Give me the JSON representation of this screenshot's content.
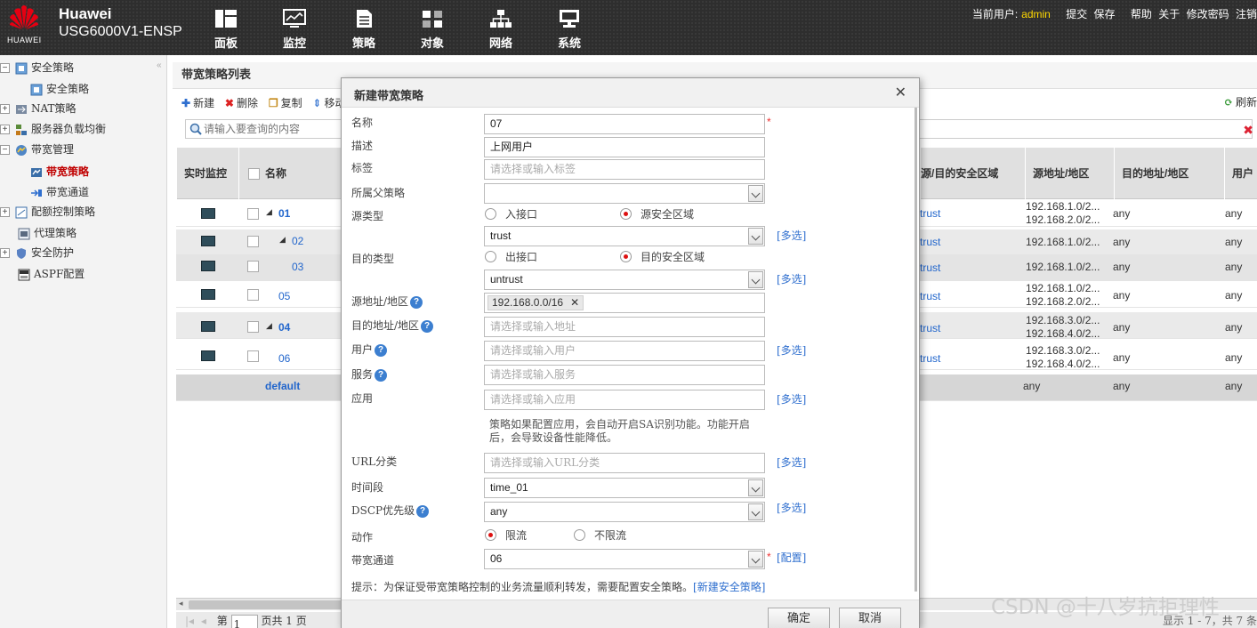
{
  "header": {
    "brand": "Huawei",
    "logo_text": "HUAWEI",
    "model": "USG6000V1-ENSP",
    "nav": [
      {
        "label": "面板",
        "icon": "dashboard-icon"
      },
      {
        "label": "监控",
        "icon": "monitor-chart-icon"
      },
      {
        "label": "策略",
        "icon": "policy-document-icon"
      },
      {
        "label": "对象",
        "icon": "objects-icon"
      },
      {
        "label": "网络",
        "icon": "network-topology-icon"
      },
      {
        "label": "系统",
        "icon": "system-computer-icon"
      }
    ],
    "user_prefix": "当前用户:",
    "username": "admin",
    "submit": "提交",
    "save": "保存",
    "help": "帮助",
    "about": "关于",
    "change_password": "修改密码",
    "logout": "注销"
  },
  "sidebar": {
    "items": [
      {
        "label": "安全策略",
        "toggle": "−"
      },
      {
        "label": "安全策略",
        "toggle": ""
      },
      {
        "label": "NAT策略",
        "toggle": "+"
      },
      {
        "label": "服务器负载均衡",
        "toggle": "+"
      },
      {
        "label": "带宽管理",
        "toggle": "−"
      },
      {
        "label": "带宽策略",
        "toggle": ""
      },
      {
        "label": "带宽通道",
        "toggle": ""
      },
      {
        "label": "配额控制策略",
        "toggle": "+"
      },
      {
        "label": "代理策略",
        "toggle": ""
      },
      {
        "label": "安全防护",
        "toggle": "+"
      },
      {
        "label": "ASPF配置",
        "toggle": ""
      }
    ]
  },
  "main": {
    "list_title": "带宽策略列表",
    "toolbar": {
      "new": "新建",
      "delete": "删除",
      "copy": "复制",
      "move": "移动",
      "refresh": "刷新"
    },
    "search_placeholder": "请输入要查询的内容",
    "columns": {
      "monitor": "实时监控",
      "name": "名称",
      "zone": "源/目的安全区域",
      "src": "源地址/地区",
      "dst": "目的地址/地区",
      "user": "用户"
    },
    "rows": [
      {
        "name": "01",
        "zone": "trust",
        "src1": "192.168.1.0/2...",
        "src2": "192.168.2.0/2...",
        "dst": "any",
        "user": "any"
      },
      {
        "name": "02",
        "zone": "trust",
        "src1": "192.168.1.0/2...",
        "src2": "",
        "dst": "any",
        "user": "any"
      },
      {
        "name": "03",
        "zone": "trust",
        "src1": "192.168.1.0/2...",
        "src2": "",
        "dst": "any",
        "user": "any"
      },
      {
        "name": "05",
        "zone": "trust",
        "src1": "192.168.1.0/2...",
        "src2": "192.168.2.0/2...",
        "dst": "any",
        "user": "any"
      },
      {
        "name": "04",
        "zone": "trust",
        "src1": "192.168.3.0/2...",
        "src2": "192.168.4.0/2...",
        "dst": "any",
        "user": "any"
      },
      {
        "name": "06",
        "zone": "trust",
        "src1": "192.168.3.0/2...",
        "src2": "192.168.4.0/2...",
        "dst": "any",
        "user": "any"
      },
      {
        "name": "default",
        "zone": "",
        "src1": "any",
        "src2": "",
        "dst": "any",
        "user": "any"
      }
    ],
    "pager": {
      "page_prefix": "第",
      "page_value": "1",
      "page_suffix": "页共 1 页",
      "summary": "显示 1 - 7，共 7 条"
    }
  },
  "dialog": {
    "title": "新建带宽策略",
    "fields": {
      "name_label": "名称",
      "name_value": "07",
      "desc_label": "描述",
      "desc_value": "上网用户",
      "tag_label": "标签",
      "tag_placeholder": "请选择或输入标签",
      "parent_label": "所属父策略",
      "parent_value": "",
      "src_type_label": "源类型",
      "src_opt1": "入接口",
      "src_opt2": "源安全区域",
      "src_zone_value": "trust",
      "dst_type_label": "目的类型",
      "dst_opt1": "出接口",
      "dst_opt2": "目的安全区域",
      "dst_zone_value": "untrust",
      "src_addr_label": "源地址/地区",
      "src_addr_tag": "192.168.0.0/16",
      "dst_addr_label": "目的地址/地区",
      "dst_addr_placeholder": "请选择或输入地址",
      "user_label": "用户",
      "user_placeholder": "请选择或输入用户",
      "service_label": "服务",
      "service_placeholder": "请选择或输入服务",
      "app_label": "应用",
      "app_placeholder": "请选择或输入应用",
      "app_note": "策略如果配置应用，会自动开启SA识别功能。功能开启后，会导致设备性能降低。",
      "url_label": "URL分类",
      "url_placeholder": "请选择或输入URL分类",
      "time_label": "时间段",
      "time_value": "time_01",
      "dscp_label": "DSCP优先级",
      "dscp_value": "any",
      "action_label": "动作",
      "action_opt1": "限流",
      "action_opt2": "不限流",
      "channel_label": "带宽通道",
      "channel_value": "06",
      "multi_select": "[多选]",
      "configure": "[配置]"
    },
    "tip_text": "提示：为保证受带宽策略控制的业务流量顺利转发，需要配置安全策略。",
    "tip_link": "[新建安全策略]",
    "ok": "确定",
    "cancel": "取消",
    "required_mark": "*"
  },
  "watermark": "CSDN @十八岁抗拒理性"
}
